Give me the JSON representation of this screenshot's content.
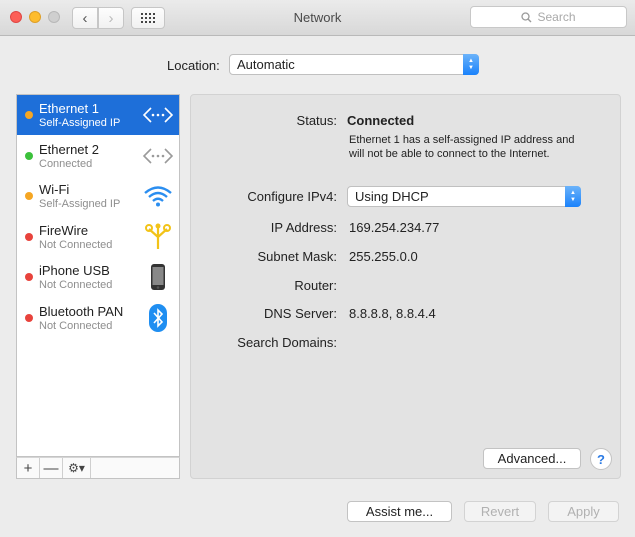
{
  "window": {
    "title": "Network"
  },
  "toolbar": {
    "back": "‹",
    "forward": "›"
  },
  "search": {
    "placeholder": "Search"
  },
  "location": {
    "label": "Location:",
    "value": "Automatic"
  },
  "services": [
    {
      "name": "Ethernet 1",
      "status": "Self-Assigned IP",
      "dot": "#f5a623",
      "icon": "ethernet-icon",
      "selected": true
    },
    {
      "name": "Ethernet 2",
      "status": "Connected",
      "dot": "#3cc13b",
      "icon": "ethernet-icon",
      "selected": false
    },
    {
      "name": "Wi-Fi",
      "status": "Self-Assigned IP",
      "dot": "#f5a623",
      "icon": "wifi-icon",
      "selected": false
    },
    {
      "name": "FireWire",
      "status": "Not Connected",
      "dot": "#e8433c",
      "icon": "firewire-icon",
      "selected": false
    },
    {
      "name": "iPhone USB",
      "status": "Not Connected",
      "dot": "#e8433c",
      "icon": "iphone-icon",
      "selected": false
    },
    {
      "name": "Bluetooth PAN",
      "status": "Not Connected",
      "dot": "#e8433c",
      "icon": "bluetooth-icon",
      "selected": false
    }
  ],
  "sidebar_bar": {
    "add": "+",
    "remove": "—"
  },
  "detail": {
    "status_label": "Status:",
    "status_value": "Connected",
    "status_desc": "Ethernet 1 has a self-assigned IP address and will not be able to connect to the Internet.",
    "ipv4_label": "Configure IPv4:",
    "ipv4_value": "Using DHCP",
    "ip_label": "IP Address:",
    "ip_value": "169.254.234.77",
    "subnet_label": "Subnet Mask:",
    "subnet_value": "255.255.0.0",
    "router_label": "Router:",
    "router_value": "",
    "dns_label": "DNS Server:",
    "dns_value": "8.8.8.8, 8.8.4.4",
    "search_domains_label": "Search Domains:",
    "search_domains_value": "",
    "advanced_label": "Advanced...",
    "help_label": "?"
  },
  "footer": {
    "assist": "Assist me...",
    "revert": "Revert",
    "apply": "Apply"
  },
  "colors": {
    "accent": "#1e6fd9",
    "stepper": "#1a82fb"
  }
}
